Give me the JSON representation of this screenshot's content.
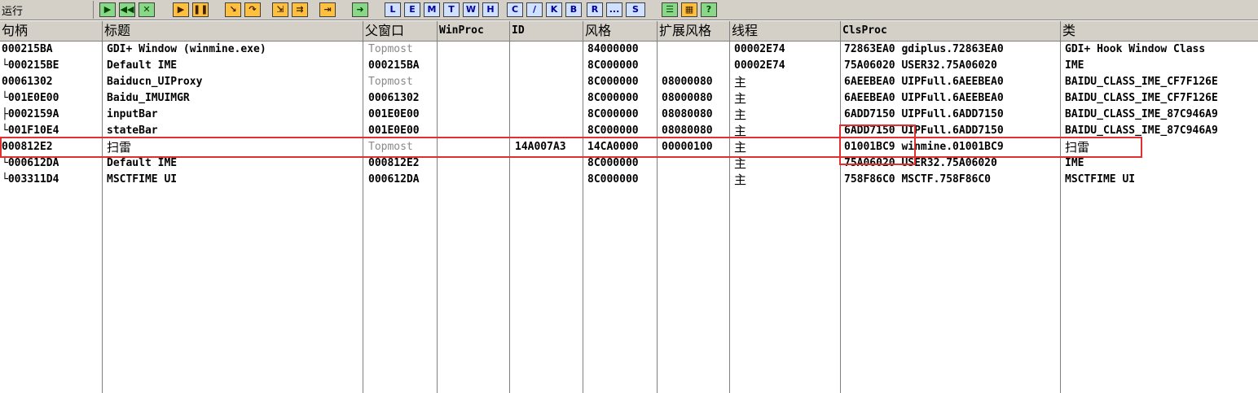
{
  "status": "运行",
  "toolbar": {
    "buttons": [
      "L",
      "E",
      "M",
      "T",
      "W",
      "H",
      "C",
      "/",
      "K",
      "B",
      "R",
      "...",
      "S",
      "?"
    ]
  },
  "columns": [
    "句柄",
    "标题",
    "父窗口",
    "WinProc",
    "ID",
    "风格",
    "扩展风格",
    "线程",
    "ClsProc",
    "类"
  ],
  "rows": [
    {
      "handle": "000215BA",
      "title": "GDI+ Window (winmine.exe)",
      "parent": "Topmost",
      "winproc": "",
      "id": "",
      "style": "84000000",
      "exstyle": "",
      "thread": "00002E74",
      "clsproc": "72863EA0 gdiplus.72863EA0",
      "class": "GDI+ Hook Window Class"
    },
    {
      "handle": "└000215BE",
      "title": "Default IME",
      "parent": "000215BA",
      "winproc": "",
      "id": "",
      "style": "8C000000",
      "exstyle": "",
      "thread": "00002E74",
      "clsproc": "75A06020 USER32.75A06020",
      "class": "IME"
    },
    {
      "handle": "00061302",
      "title": "Baiducn_UIProxy",
      "parent": "Topmost",
      "winproc": "",
      "id": "",
      "style": "8C000000",
      "exstyle": "08000080",
      "thread": "主",
      "clsproc": "6AEEBEA0 UIPFull.6AEEBEA0",
      "class": "BAIDU_CLASS_IME_CF7F126E"
    },
    {
      "handle": "└001E0E00",
      "title": "Baidu_IMUIMGR",
      "parent": "00061302",
      "winproc": "",
      "id": "",
      "style": "8C000000",
      "exstyle": "08000080",
      "thread": "主",
      "clsproc": "6AEEBEA0 UIPFull.6AEEBEA0",
      "class": "BAIDU_CLASS_IME_CF7F126E"
    },
    {
      "handle": "├0002159A",
      "title": "inputBar",
      "parent": "001E0E00",
      "winproc": "",
      "id": "",
      "style": "8C000000",
      "exstyle": "08080080",
      "thread": "主",
      "clsproc": "6ADD7150 UIPFull.6ADD7150",
      "class": "BAIDU_CLASS_IME_87C946A9"
    },
    {
      "handle": "└001F10E4",
      "title": "stateBar",
      "parent": "001E0E00",
      "winproc": "",
      "id": "",
      "style": "8C000000",
      "exstyle": "08080080",
      "thread": "主",
      "clsproc": "6ADD7150 UIPFull.6ADD7150",
      "class": "BAIDU_CLASS_IME_87C946A9"
    },
    {
      "handle": "000812E2",
      "title": "扫雷",
      "parent": "Topmost",
      "winproc": "",
      "id": "14A007A3",
      "style": "14CA0000",
      "exstyle": "00000100",
      "thread": "主",
      "clsproc": "01001BC9 winmine.01001BC9",
      "class": "扫雷"
    },
    {
      "handle": "└000612DA",
      "title": "Default IME",
      "parent": "000812E2",
      "winproc": "",
      "id": "",
      "style": "8C000000",
      "exstyle": "",
      "thread": "主",
      "clsproc": "75A06020 USER32.75A06020",
      "class": "IME"
    },
    {
      "handle": "└003311D4",
      "title": "MSCTFIME UI",
      "parent": "000612DA",
      "winproc": "",
      "id": "",
      "style": "8C000000",
      "exstyle": "",
      "thread": "主",
      "clsproc": "758F86C0 MSCTF.758F86C0",
      "class": "MSCTFIME UI"
    }
  ]
}
